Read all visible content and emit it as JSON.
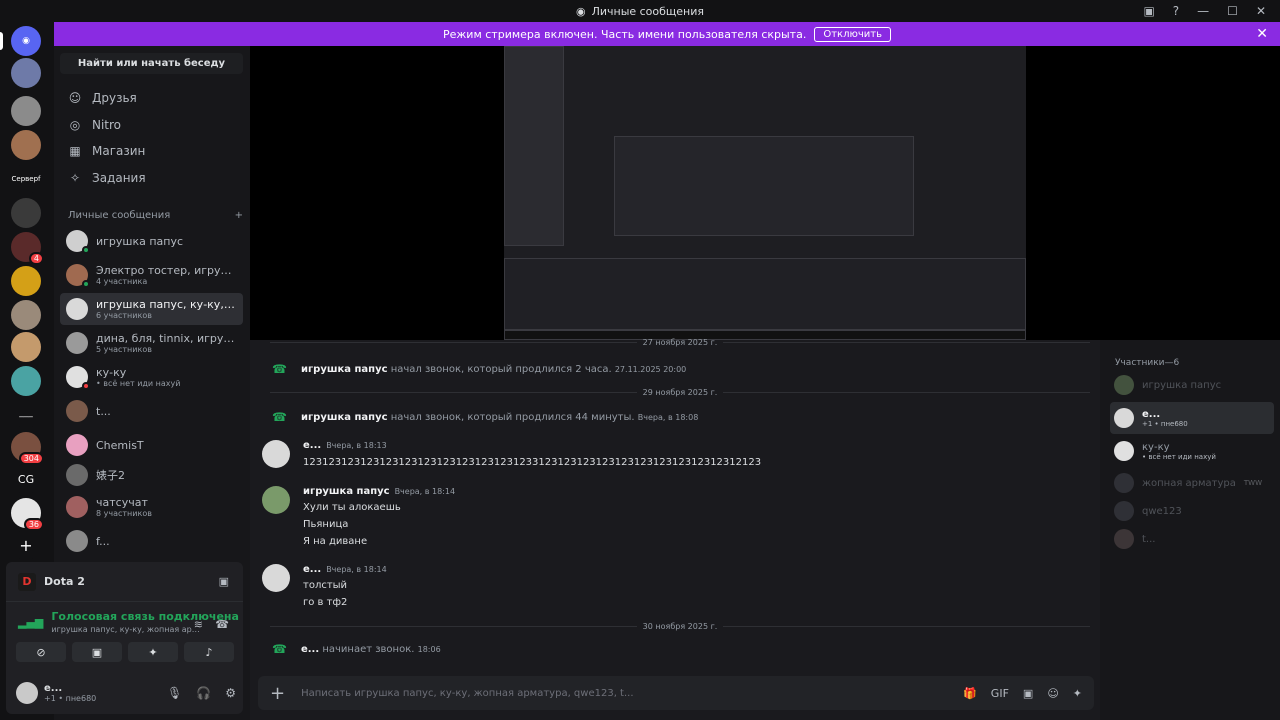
{
  "window": {
    "title": "Личные сообщения"
  },
  "banner": {
    "text": "Режим стримера включен. Часть имени пользователя скрыта.",
    "button": "Отключить"
  },
  "servers": [
    {
      "label": "",
      "badge": ""
    },
    {
      "label": "",
      "badge": ""
    },
    {
      "label": "",
      "badge": ""
    },
    {
      "label": "",
      "badge": ""
    },
    {
      "label": "Серверf",
      "badge": ""
    },
    {
      "label": "",
      "badge": ""
    },
    {
      "label": "",
      "badge": "4"
    },
    {
      "label": "",
      "badge": ""
    },
    {
      "label": "",
      "badge": ""
    },
    {
      "label": "",
      "badge": ""
    },
    {
      "label": "",
      "badge": ""
    },
    {
      "label": "___",
      "badge": ""
    },
    {
      "label": "",
      "badge": "304"
    },
    {
      "label": "CG",
      "badge": ""
    },
    {
      "label": "",
      "badge": "36"
    },
    {
      "label": "+",
      "badge": ""
    }
  ],
  "sidebar": {
    "search": "Найти или начать беседу",
    "nav": [
      {
        "label": "Друзья",
        "icon": "friends-icon"
      },
      {
        "label": "Nitro",
        "icon": "nitro-icon"
      },
      {
        "label": "Магазин",
        "icon": "shop-icon"
      },
      {
        "label": "Задания",
        "icon": "quests-icon"
      }
    ],
    "dm_header": "Личные сообщения",
    "dms": [
      {
        "name": "игрушка папус",
        "sub": ""
      },
      {
        "name": "Электро тостер, игрушка п...",
        "sub": "4 участника"
      },
      {
        "name": "игрушка папус, ку-ку, жопн...",
        "sub": "6 участников"
      },
      {
        "name": "дина, бля, tinnix, игрушка п...",
        "sub": "5 участников"
      },
      {
        "name": "ку-ку",
        "sub": "• всё нет иди нахуй"
      },
      {
        "name": "t...",
        "sub": ""
      },
      {
        "name": "ChemisT",
        "sub": ""
      },
      {
        "name": "婊子2",
        "sub": ""
      },
      {
        "name": "чатсучат",
        "sub": "8 участников"
      },
      {
        "name": "f...",
        "sub": ""
      }
    ]
  },
  "activity": {
    "game": "Dota 2",
    "voice_status": "Голосовая связь подключена",
    "voice_channel": "игрушка папус, ку-ку, жопная арматура, ..."
  },
  "user": {
    "name": "е...",
    "status": "+1 • пне680"
  },
  "chat": {
    "dates": [
      "27 ноября 2025 г.",
      "29 ноября 2025 г.",
      "30 ноября 2025 г."
    ],
    "calls": [
      {
        "author": "игрушка папус",
        "text": "начал звонок, который продлился 2 часа.",
        "time": "27.11.2025 20:00"
      },
      {
        "author": "игрушка папус",
        "text": "начал звонок, который продлился 44 минуты.",
        "time": "Вчера, в 18:08"
      },
      {
        "author": "е...",
        "text": "начинает звонок.",
        "time": "18:06"
      }
    ],
    "messages": [
      {
        "author": "е...",
        "time": "Вчера, в 18:13",
        "lines": [
          "123123123123123123123123123123123123312312312312312312312312312312312123"
        ]
      },
      {
        "author": "игрушка папус",
        "time": "Вчера, в 18:14",
        "lines": [
          "Хули ты алокаешь",
          "Пьяница",
          "Я на диване"
        ]
      },
      {
        "author": "е...",
        "time": "Вчера, в 18:14",
        "lines": [
          "толстый",
          "го в тф2"
        ]
      }
    ],
    "composer_placeholder": "Написать игрушка папус, ку-ку, жопная арматура, qwe123, t..."
  },
  "members": {
    "header": "Участники—6",
    "list": [
      {
        "name": "игрушка папус",
        "status": ""
      },
      {
        "name": "е...",
        "status": "+1 • пне680"
      },
      {
        "name": "ку-ку",
        "status": "• всё нет иди нахуй"
      },
      {
        "name": "жопная арматура",
        "status": "TWW"
      },
      {
        "name": "qwe123",
        "status": ""
      },
      {
        "name": "t...",
        "status": ""
      }
    ]
  }
}
